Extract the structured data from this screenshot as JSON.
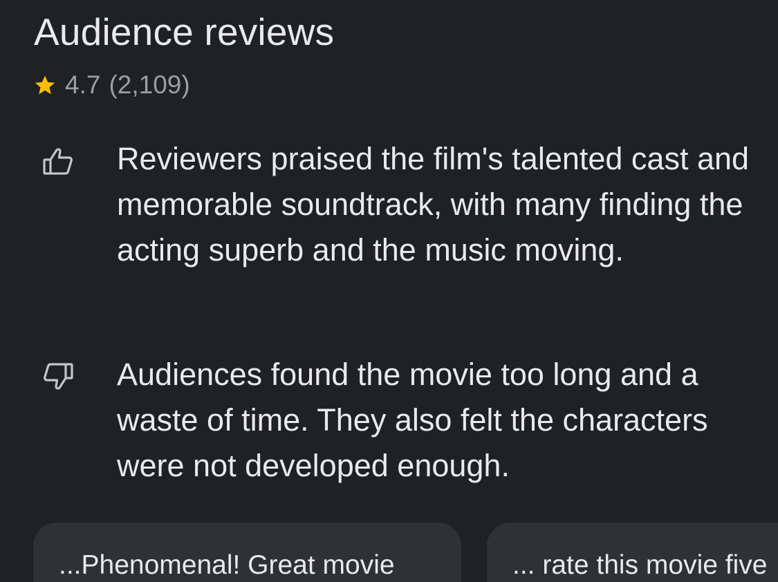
{
  "section": {
    "title": "Audience reviews"
  },
  "rating": {
    "value": "4.7",
    "count": "(2,109)",
    "star_icon": "star-icon",
    "star_color": "#fbbc04"
  },
  "summaries": [
    {
      "sentiment": "positive",
      "icon": "thumbs-up-icon",
      "text": "Reviewers praised the film's talented cast and memorable soundtrack, with many finding the acting superb and the music moving."
    },
    {
      "sentiment": "negative",
      "icon": "thumbs-down-icon",
      "text": "Audiences found the movie too long and a waste of time. They also felt the characters were not developed enough."
    }
  ],
  "snippets": [
    {
      "text": "...Phenomenal! Great movie"
    },
    {
      "text": "... rate this movie five"
    }
  ],
  "colors": {
    "background": "#202124",
    "text_primary": "#e8eaed",
    "text_secondary": "#9aa0a6",
    "chip_background": "#303134",
    "icon": "#c4c7c5"
  }
}
